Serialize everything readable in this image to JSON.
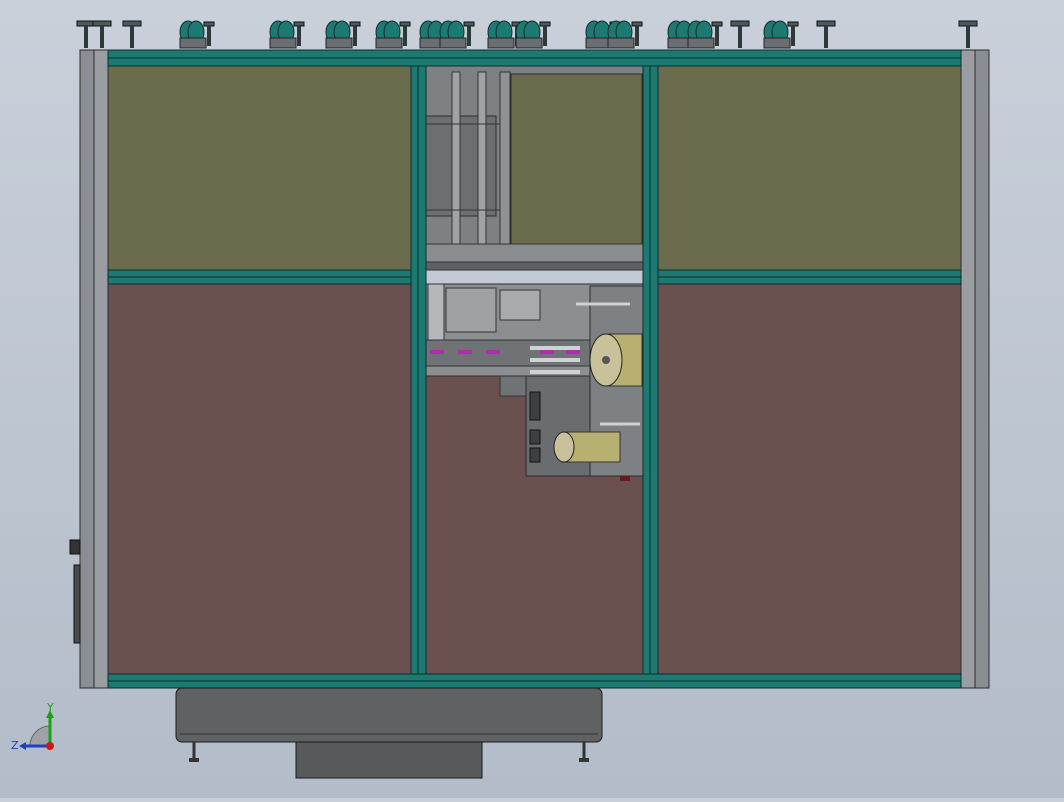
{
  "view": {
    "background_top": "#c9d0da",
    "background_bottom": "#b3bcc9"
  },
  "colors": {
    "frame_teal": "#1d7a72",
    "frame_dark": "#2c3a3a",
    "post_grey": "#8a8e92",
    "panel_upper": "#6b6b4d",
    "panel_lower": "#6b5050",
    "machine_grey": "#7a7d80",
    "base_grey": "#5f6163",
    "accent_magenta": "#b02bb0",
    "accent_yellow": "#b8b070"
  },
  "triad": {
    "y_label": "Y",
    "z_label": "Z",
    "x_color": "#d01818",
    "y_color": "#18a018",
    "z_color": "#2040c0"
  },
  "icons": [
    "caster-wheel-icon",
    "leveling-foot-icon",
    "coordinate-triad-icon"
  ]
}
